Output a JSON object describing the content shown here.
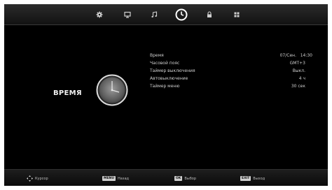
{
  "tabs": [
    {
      "id": "picture",
      "icon": "gear-icon",
      "active": false
    },
    {
      "id": "screen",
      "icon": "monitor-icon",
      "active": false
    },
    {
      "id": "sound",
      "icon": "music-note-icon",
      "active": false
    },
    {
      "id": "time",
      "icon": "clock-icon",
      "active": true
    },
    {
      "id": "lock",
      "icon": "lock-icon",
      "active": false
    },
    {
      "id": "setup",
      "icon": "grid-icon",
      "active": false
    }
  ],
  "section": {
    "title": "ВРЕМЯ",
    "icon": "clock-icon"
  },
  "menu": [
    {
      "label": "Время",
      "value": "07/Сен.   14:30"
    },
    {
      "label": "Часовой пояс",
      "value": "GMT+3"
    },
    {
      "label": "Таймер выключения",
      "value": "Выкл."
    },
    {
      "label": "Автовыключение",
      "value": "4 ч"
    },
    {
      "label": "Таймер меню",
      "value": "30 сек"
    }
  ],
  "footer": {
    "cursor_text": "Курсор",
    "back_key": "MENU",
    "back_text": "Назад",
    "ok_key": "OK",
    "ok_text": "Выбор",
    "exit_key": "EXIT",
    "exit_text": "Выход"
  },
  "colors": {
    "background": "#000000",
    "text": "#cfcfcf",
    "active_tab": "#ffffff"
  }
}
